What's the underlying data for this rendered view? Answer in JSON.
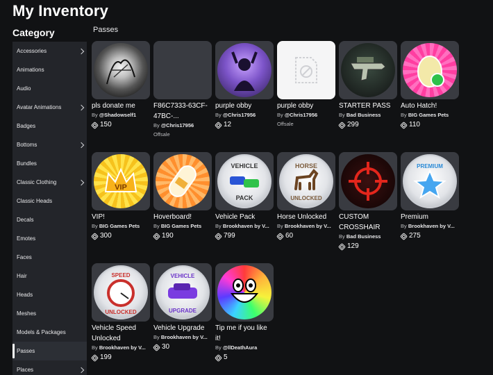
{
  "page": {
    "title": "My Inventory"
  },
  "sidebar": {
    "heading": "Category",
    "items": [
      {
        "label": "Accessories",
        "chevron": true
      },
      {
        "label": "Animations",
        "chevron": false
      },
      {
        "label": "Audio",
        "chevron": false
      },
      {
        "label": "Avatar Animations",
        "chevron": true
      },
      {
        "label": "Badges",
        "chevron": false
      },
      {
        "label": "Bottoms",
        "chevron": true
      },
      {
        "label": "Bundles",
        "chevron": false
      },
      {
        "label": "Classic Clothing",
        "chevron": true
      },
      {
        "label": "Classic Heads",
        "chevron": false
      },
      {
        "label": "Decals",
        "chevron": false
      },
      {
        "label": "Emotes",
        "chevron": false
      },
      {
        "label": "Faces",
        "chevron": false
      },
      {
        "label": "Hair",
        "chevron": false
      },
      {
        "label": "Heads",
        "chevron": false
      },
      {
        "label": "Meshes",
        "chevron": false
      },
      {
        "label": "Models & Packages",
        "chevron": false
      },
      {
        "label": "Passes",
        "chevron": false,
        "active": true
      },
      {
        "label": "Places",
        "chevron": true
      }
    ]
  },
  "main": {
    "section_label": "Passes",
    "items": [
      {
        "name": "pls donate me",
        "by": "By",
        "creator": "@Shadowself1",
        "price": "150"
      },
      {
        "name": "F86C7333-63CF-47BC-...",
        "by": "By",
        "creator": "@Chris17956",
        "offsale": "Offsale"
      },
      {
        "name": "purple obby",
        "by": "By",
        "creator": "@Chris17956",
        "price": "12"
      },
      {
        "name": "purple obby",
        "by": "By",
        "creator": "@Chris17956",
        "offsale": "Offsale"
      },
      {
        "name": "STARTER PASS",
        "by": "By",
        "creator": "Bad Business",
        "price": "299"
      },
      {
        "name": "Auto Hatch!",
        "by": "By",
        "creator": "BIG Games Pets",
        "price": "110"
      },
      {
        "name": "VIP!",
        "by": "By",
        "creator": "BIG Games Pets",
        "price": "300"
      },
      {
        "name": "Hoverboard!",
        "by": "By",
        "creator": "BIG Games Pets",
        "price": "190"
      },
      {
        "name": "Vehicle Pack",
        "by": "By",
        "creator": "Brookhaven by V...",
        "price": "799"
      },
      {
        "name": "Horse Unlocked",
        "by": "By",
        "creator": "Brookhaven by V...",
        "price": "60"
      },
      {
        "name": "CUSTOM CROSSHAIR",
        "by": "By",
        "creator": "Bad Business",
        "price": "129"
      },
      {
        "name": "Premium",
        "by": "By",
        "creator": "Brookhaven by V...",
        "price": "275"
      },
      {
        "name": "Vehicle Speed Unlocked",
        "by": "By",
        "creator": "Brookhaven by V...",
        "price": "199"
      },
      {
        "name": "Vehicle Upgrade",
        "by": "By",
        "creator": "Brookhaven by V...",
        "price": "30"
      },
      {
        "name": "Tip me if you like it!",
        "by": "By",
        "creator": "@llDeathAura",
        "price": "5"
      }
    ],
    "thumb_texts": {
      "vip": "VIP",
      "vehicle_pack_top": "VEHICLE",
      "vehicle_pack_bottom": "PACK",
      "horse_top": "HORSE",
      "horse_bottom": "UNLOCKED",
      "premium": "PREMIUM",
      "speed_top": "SPEED",
      "speed_bottom": "UNLOCKED",
      "upgrade_top": "VEHICLE",
      "upgrade_bottom": "UPGRADE"
    }
  }
}
